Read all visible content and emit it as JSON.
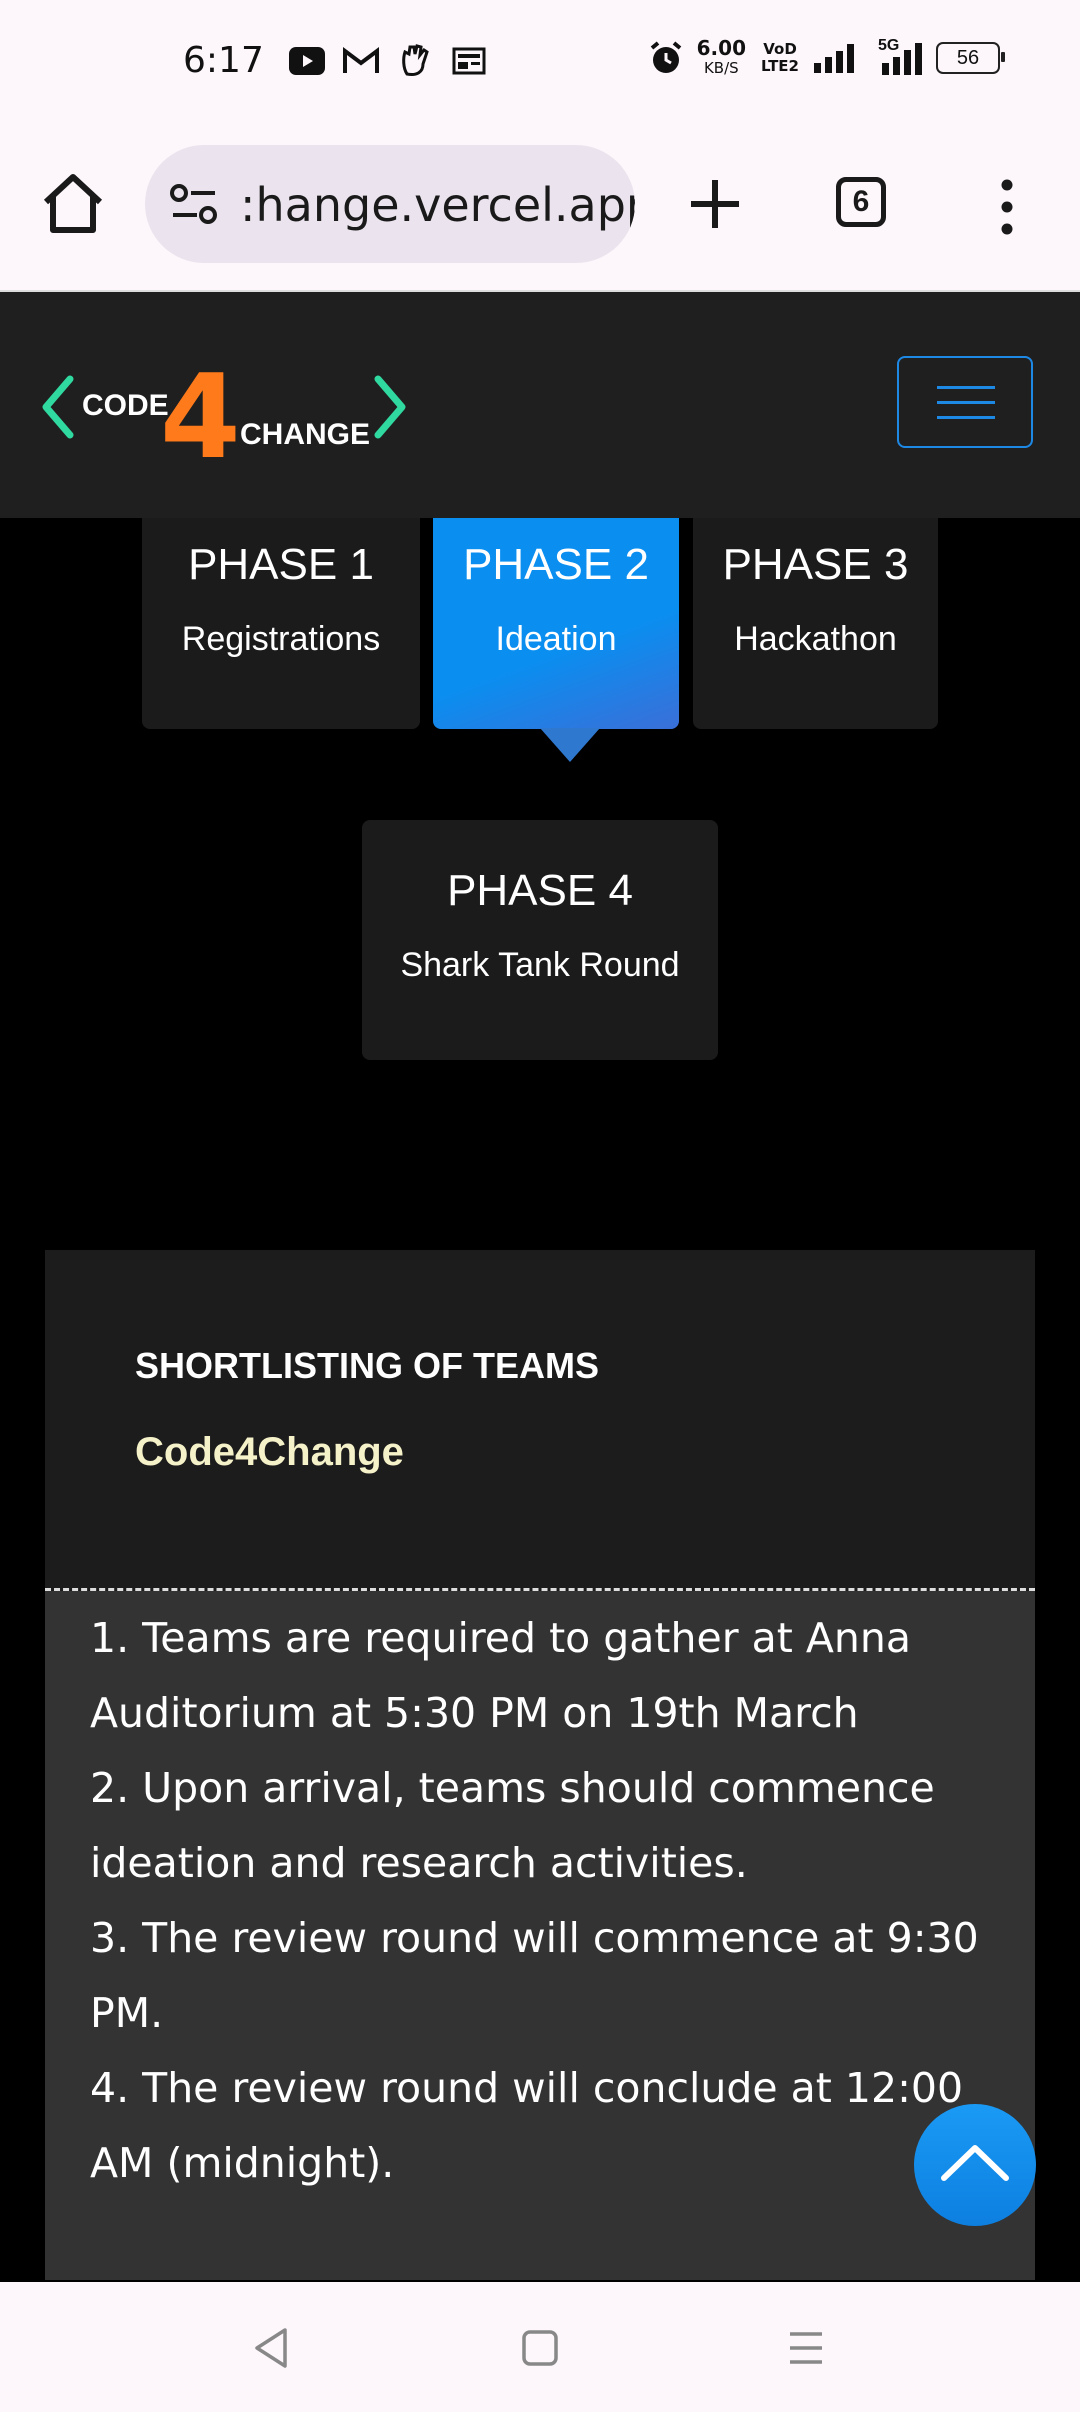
{
  "status_bar": {
    "time": "6:17",
    "net_speed": "6.00",
    "net_unit": "KB/S",
    "volte": "VoD LTE2",
    "net_5g": "5G",
    "battery": "56"
  },
  "browser": {
    "url": ":hange.vercel.app",
    "tab_count": "6"
  },
  "site": {
    "logo_left": "CODE",
    "logo_digit": "4",
    "logo_right": "CHANGE"
  },
  "phases": [
    {
      "title": "PHASE 1",
      "subtitle": "Registrations",
      "active": false
    },
    {
      "title": "PHASE 2",
      "subtitle": "Ideation",
      "active": true
    },
    {
      "title": "PHASE 3",
      "subtitle": "Hackathon",
      "active": false
    },
    {
      "title": "PHASE 4",
      "subtitle": "Shark Tank Round",
      "active": false
    }
  ],
  "event": {
    "title": "SHORTLISTING OF TEAMS",
    "organizer": "Code4Change",
    "items": [
      "1. Teams are required to gather at Anna Auditorium at 5:30 PM on 19th March",
      "2. Upon arrival, teams should commence ideation and research activities.",
      "3. The review round will commence at 9:30 PM.",
      "4. The review round will conclude at 12:00 AM (midnight)."
    ]
  },
  "colors": {
    "accent_blue": "#0a8ef0",
    "logo_orange": "#ff7a1a",
    "logo_green": "#2fd9a0",
    "organizer_text": "#f5f1c8"
  }
}
